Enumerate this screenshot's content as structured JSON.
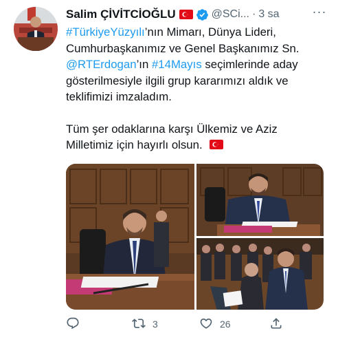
{
  "tweet": {
    "author_name": "Salim ÇİVİTCİOĞLU",
    "handle": "@SCi...",
    "separator": "·",
    "time": "3 sa",
    "more_label": "···",
    "lines": {
      "l1_link": "#TürkiyeYüzyılı",
      "l1_text": "’nın Mimarı, Dünya Lideri,",
      "l2_text": "Cumhurbaşkanımız ve Genel Başkanımız Sn.",
      "l3_link1": "@RTErdogan",
      "l3_text1": "’ın ",
      "l3_link2": "#14Mayıs",
      "l3_text2": " seçimlerinde aday",
      "l4_text": "gösterilmesiyle ilgili grup kararımızı aldık ve",
      "l5_text": "teklifimizi imzaladım.",
      "l6_text": "Tüm şer odaklarına karşı Ülkemiz ve Aziz",
      "l7_text": "Milletimiz için hayırlı olsun."
    }
  },
  "actions": {
    "reply_count": "",
    "retweet_count": "3",
    "like_count": "26",
    "share_count": ""
  },
  "icons": {
    "avatar": "profile-photo",
    "flag": "turkey-flag-emoji",
    "verified": "verified-badge-icon",
    "reply": "reply-icon",
    "retweet": "retweet-icon",
    "like": "heart-icon",
    "share": "share-icon"
  },
  "colors": {
    "link": "#1d9bf0",
    "muted": "#536471",
    "text": "#0f1419",
    "flag_red": "#e30a17"
  }
}
